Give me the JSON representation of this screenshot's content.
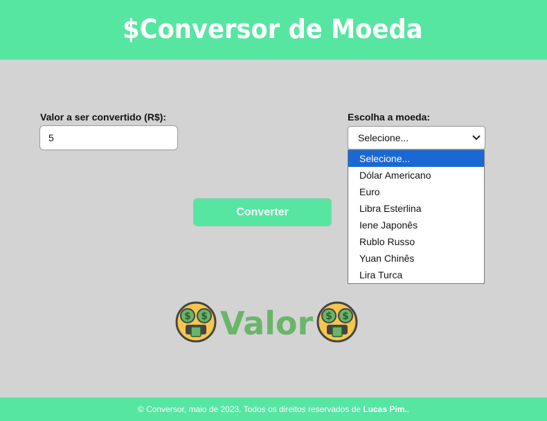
{
  "header": {
    "title": "$Conversor de Moeda"
  },
  "form": {
    "amount_label": "Valor a ser convertido (R$):",
    "amount_value": "5",
    "currency_label": "Escolha a moeda:",
    "currency_selected": "Selecione...",
    "currency_options": [
      "Selecione...",
      "Dólar Americano",
      "Euro",
      "Libra Esterlina",
      "Iene Japonês",
      "Rublo Russo",
      "Yuan Chinês",
      "Lira Turca"
    ],
    "convert_label": "Converter"
  },
  "result": {
    "text": "Valor",
    "icon": "money-mouth-face-icon"
  },
  "footer": {
    "prefix": "© Conversor, maio de 2023. Todos os direitos reservados de ",
    "author": "Lucas Pim.",
    "suffix": "."
  },
  "colors": {
    "header_bg": "#56e6a2",
    "page_bg": "#d3d3d3",
    "result_text": "#6ab56a",
    "highlight": "#1a68d3"
  }
}
